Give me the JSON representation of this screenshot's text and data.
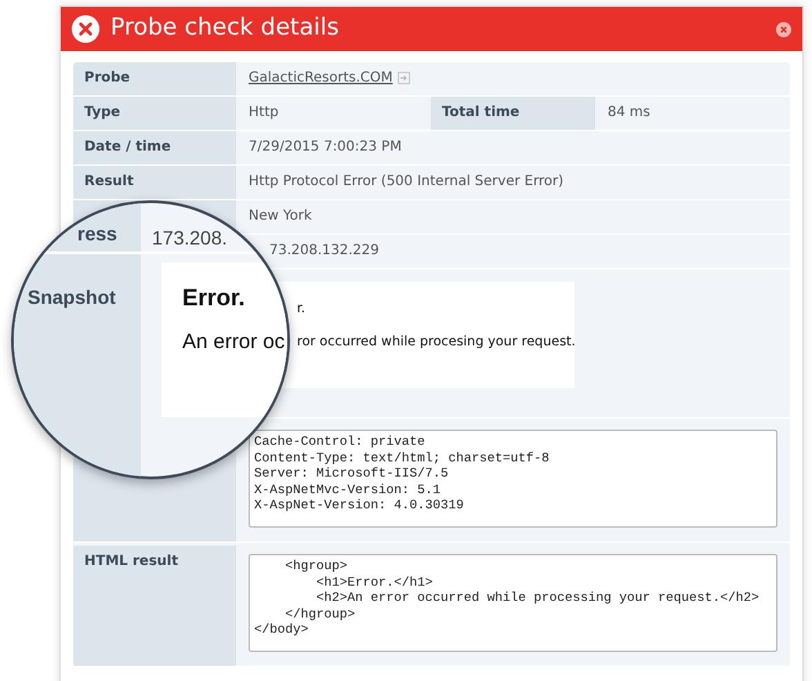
{
  "dialog": {
    "title": "Probe check details"
  },
  "rows": [
    {
      "kind": "link",
      "label": "Probe",
      "value": "GalacticResorts.COM"
    },
    {
      "kind": "pair",
      "label": "Type",
      "value": "Http",
      "label_2": "Total time",
      "value_2": "84 ms"
    },
    {
      "kind": "text",
      "label": "Date / time",
      "value": "7/29/2015 7:00:23 PM"
    },
    {
      "kind": "text",
      "label": "Result",
      "value": "Http Protocol Error (500 Internal Server Error)"
    },
    {
      "kind": "text",
      "value": "New York"
    },
    {
      "kind": "clipped",
      "value": "73.208.132.229"
    },
    {
      "kind": "snapshot",
      "heading": "r.",
      "message": "ror occurred while procesing your request."
    },
    {
      "kind": "code",
      "lines": [
        "Cache-Control: private",
        "Content-Type: text/html; charset=utf-8",
        "Server: Microsoft-IIS/7.5",
        "X-AspNetMvc-Version: 5.1",
        "X-AspNet-Version: 4.0.30319"
      ]
    },
    {
      "kind": "code",
      "label": "HTML result",
      "lines": [
        "    <hgroup>",
        "        <h1>Error.</h1>",
        "        <h2>An error occurred while processing your request.</h2>",
        "    </hgroup>",
        "</body>"
      ]
    }
  ],
  "magnifier": {
    "label_1": "ress",
    "value_1": "173.208.",
    "label_2": "Snapshot",
    "heading": "Error.",
    "message": "An error oc"
  }
}
